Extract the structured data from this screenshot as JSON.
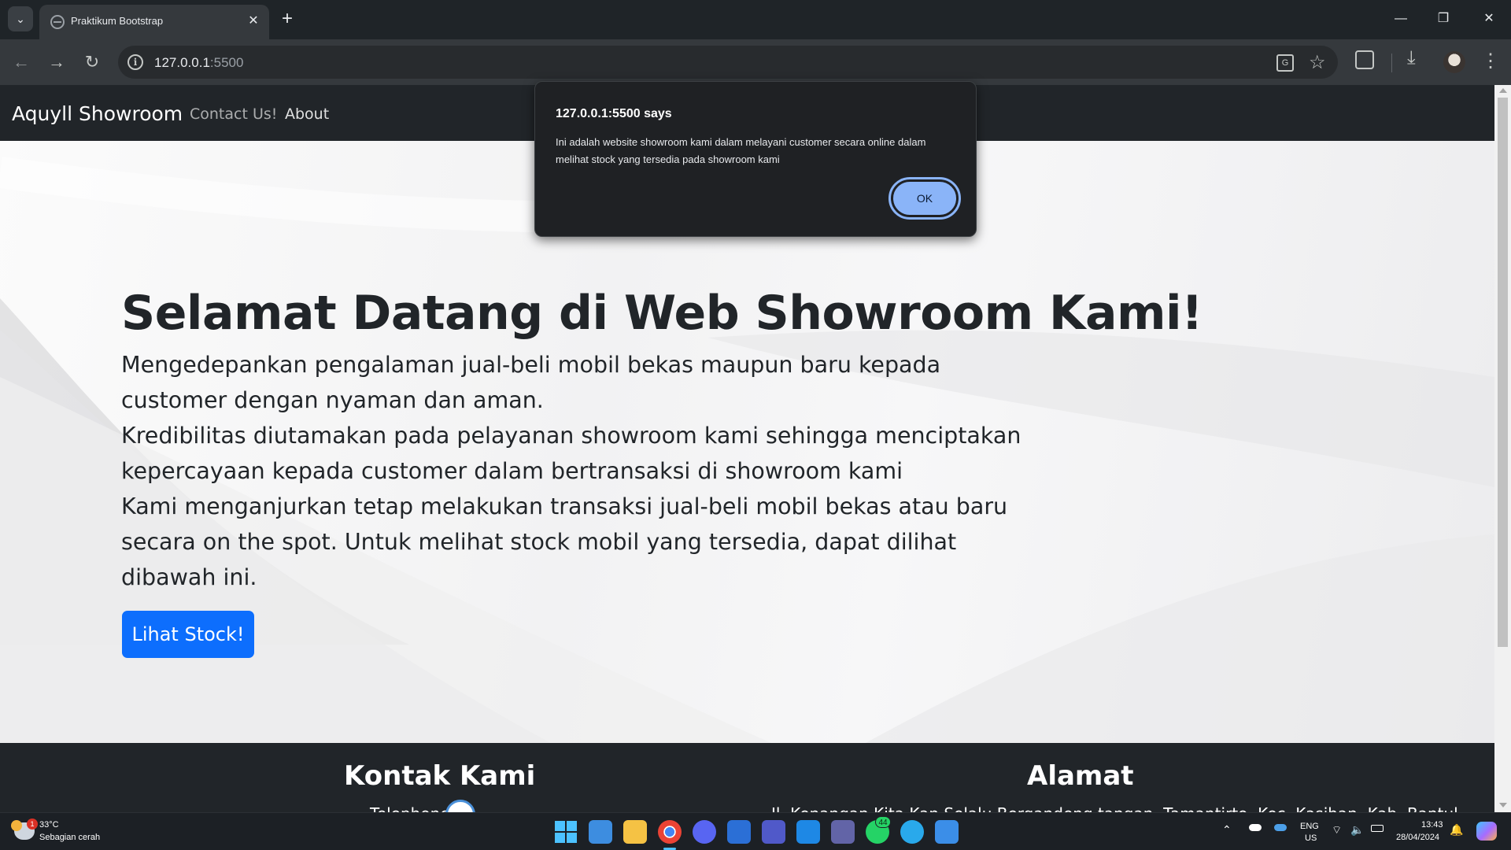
{
  "browser": {
    "tab_title": "Praktikum Bootstrap",
    "tab_close": "✕",
    "new_tab": "+",
    "url_host": "127.0.0.1",
    "url_port": ":5500",
    "window_controls": {
      "minimize": "—",
      "maximize": "❐",
      "close": "✕"
    },
    "icons": [
      "tab-search-icon",
      "back-icon",
      "forward-icon",
      "reload-icon",
      "site-info-icon",
      "translate-icon",
      "star-icon",
      "extensions-icon",
      "download-icon",
      "avatar",
      "menu-icon"
    ]
  },
  "site": {
    "brand": "Aquyll Showroom",
    "nav": {
      "contact": "Contact Us!",
      "about": "About"
    },
    "hero": {
      "title": "Selamat Datang di Web Showroom Kami!",
      "lines": [
        "Mengedepankan pengalaman jual-beli mobil bekas maupun baru kepada",
        "customer dengan nyaman dan aman.",
        "Kredibilitas diutamakan pada pelayanan showroom kami sehingga menciptakan",
        "kepercayaan kepada customer dalam bertransaksi di showroom kami",
        "Kami menganjurkan tetap melakukan transaksi jual-beli mobil bekas atau baru",
        "secara on the spot. Untuk melihat stock mobil yang tersedia, dapat dilihat",
        "dibawah ini."
      ],
      "button": "Lihat Stock!",
      "button_color": "#0d6efd"
    },
    "footer": {
      "contact_heading": "Kontak Kami",
      "phone_label": "Telephone",
      "address_heading": "Alamat",
      "address_text": "Jl. Kenangan Kita Kan Selalu Bergandeng tangan, Tamantirto, Kec. Kasihan, Kab. Bantul"
    }
  },
  "alert": {
    "title": "127.0.0.1:5500 says",
    "message": "Ini adalah website showroom kami dalam melayani customer secara online dalam melihat stock yang tersedia pada showroom kami",
    "ok": "OK",
    "ok_color": "#8ab4f8"
  },
  "taskbar": {
    "weather_badge": "1",
    "weather_temp": "33°C",
    "weather_desc": "Sebagian cerah",
    "whatsapp_badge": "44",
    "apps": [
      "start",
      "notepad",
      "file-explorer",
      "chrome",
      "discord",
      "microsoft-store",
      "teams",
      "vscode",
      "teams-classic",
      "whatsapp",
      "telegram",
      "paint"
    ],
    "lang_top": "ENG",
    "lang_bottom": "US",
    "time": "13:43",
    "date": "28/04/2024"
  }
}
